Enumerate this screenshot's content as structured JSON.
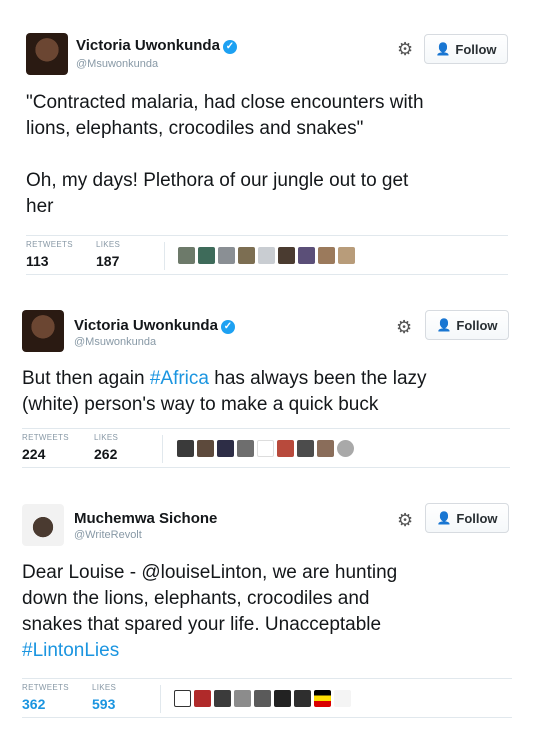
{
  "tweets": [
    {
      "display_name": "Victoria Uwonkunda",
      "handle": "@Msuwonkunda",
      "follow_label": "Follow",
      "text_lines": [
        "\"Contracted malaria, had close encounters with",
        "lions, elephants, crocodiles and snakes\"",
        "",
        "Oh, my days! Plethora of our jungle out to get",
        "her"
      ],
      "retweets_label": "RETWEETS",
      "retweets": "113",
      "likes_label": "LIKES",
      "likes": "187"
    },
    {
      "display_name": "Victoria Uwonkunda",
      "handle": "@Msuwonkunda",
      "follow_label": "Follow",
      "text_prefix": "But then again ",
      "hashtag": "#Africa",
      "text_suffix": " has always been the lazy",
      "text_line2": "(white) person's way to make a quick buck",
      "retweets_label": "RETWEETS",
      "retweets": "224",
      "likes_label": "LIKES",
      "likes": "262"
    },
    {
      "display_name": "Muchemwa Sichone",
      "handle": "@WriteRevolt",
      "follow_label": "Follow",
      "text_lines": [
        "Dear Louise - @louiseLinton, we are hunting",
        "down the lions, elephants, crocodiles and",
        "snakes that spared your life. Unacceptable"
      ],
      "hashtag": "#LintonLies",
      "retweets_label": "RETWEETS",
      "retweets": "362",
      "likes_label": "LIKES",
      "likes": "593"
    }
  ],
  "icons": {
    "verified": "verified-badge-icon",
    "gear": "gear-icon",
    "follow": "add-user-icon"
  },
  "colors": {
    "link": "#1b95e0",
    "brand": "#1da1f2",
    "muted": "#8899a6"
  }
}
